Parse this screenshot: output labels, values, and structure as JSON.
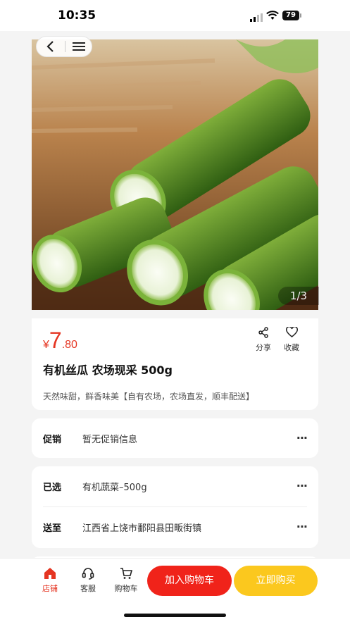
{
  "status": {
    "time": "10:35",
    "battery": "79"
  },
  "gallery": {
    "page_indicator": "1/3"
  },
  "product": {
    "price_currency": "¥",
    "price_integer": "7",
    "price_decimal": ".80",
    "title": "有机丝瓜 农场现采 500g",
    "subtitle": "天然味甜，鲜香味美【自有农场，农场直发，顺丰配送】",
    "share_label": "分享",
    "favorite_label": "收藏"
  },
  "promotion": {
    "label": "促销",
    "value": "暂无促销信息"
  },
  "spec": {
    "label": "已选",
    "value": "有机蔬菜–500g"
  },
  "delivery": {
    "label": "送至",
    "value": "江西省上饶市鄱阳县田畈街镇"
  },
  "more_glyph": "···",
  "bottom_bar": {
    "store_label": "店铺",
    "service_label": "客服",
    "cart_label": "购物车",
    "add_to_cart_label": "加入购物车",
    "buy_now_label": "立即购买"
  },
  "colors": {
    "accent_red": "#e53522",
    "cart_button": "#f0231a",
    "buy_button": "#fbc81e"
  },
  "icons": [
    "back-icon",
    "menu-icon",
    "share-icon",
    "heart-icon",
    "store-icon",
    "headset-icon",
    "cart-icon",
    "more-icon"
  ]
}
